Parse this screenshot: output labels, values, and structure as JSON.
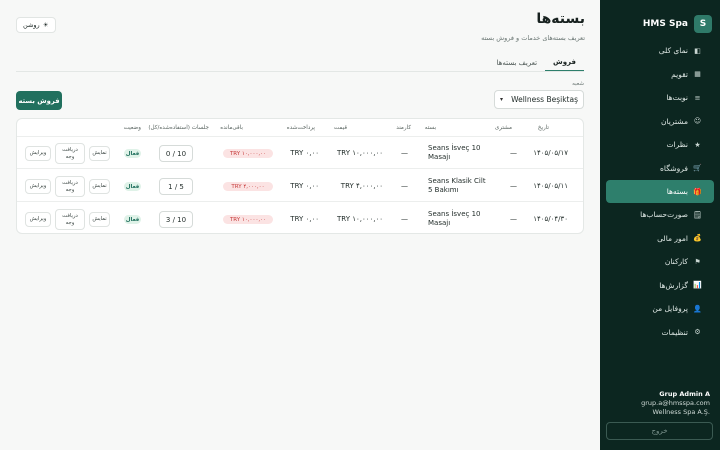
{
  "brand": {
    "logo": "S",
    "name": "HMS Spa"
  },
  "nav": [
    {
      "label": "نمای کلی",
      "icon": "dashboard-icon",
      "glyph": "◧",
      "active": false
    },
    {
      "label": "تقویم",
      "icon": "calendar-icon",
      "glyph": "▦",
      "active": false
    },
    {
      "label": "نوبت‌ها",
      "icon": "list-icon",
      "glyph": "≡",
      "active": false
    },
    {
      "label": "مشتریان",
      "icon": "users-icon",
      "glyph": "☺",
      "active": false
    },
    {
      "label": "نظرات",
      "icon": "star-icon",
      "glyph": "★",
      "active": false
    },
    {
      "label": "فروشگاه",
      "icon": "cart-icon",
      "glyph": "🛒",
      "active": false
    },
    {
      "label": "بسته‌ها",
      "icon": "gift-icon",
      "glyph": "🎁",
      "active": true
    },
    {
      "label": "صورت‌حساب‌ها",
      "icon": "receipt-icon",
      "glyph": "🗒",
      "active": false
    },
    {
      "label": "امور مالی",
      "icon": "money-icon",
      "glyph": "💰",
      "active": false
    },
    {
      "label": "کارکنان",
      "icon": "flag-icon",
      "glyph": "⚑",
      "active": false
    },
    {
      "label": "گزارش‌ها",
      "icon": "report-icon",
      "glyph": "📊",
      "active": false
    },
    {
      "label": "پروفایل من",
      "icon": "profile-icon",
      "glyph": "👤",
      "active": false
    },
    {
      "label": "تنظیمات",
      "icon": "gear-icon",
      "glyph": "⚙",
      "active": false
    }
  ],
  "user": {
    "name": "Grup Admin A",
    "email": "grup.a@hmsspa.com",
    "company": "Wellness Spa A.Ş."
  },
  "logout_label": "خروج",
  "page": {
    "title": "بسته‌ها",
    "subtitle": "تعریف بسته‌های خدمات و فروش بسته",
    "theme_label": "روشن",
    "theme_glyph": "☀"
  },
  "tabs": [
    {
      "label": "فروش",
      "active": true
    },
    {
      "label": "تعریف بسته‌ها",
      "active": false
    }
  ],
  "filter": {
    "label": "شعبه",
    "value": "Wellness Beşiktaş",
    "chevron": "▾"
  },
  "sell_button": "فروش بسته",
  "table": {
    "headers": {
      "date": "تاریخ",
      "customer": "مشتری",
      "package": "بسته",
      "staff": "کارمند",
      "price": "قیمت",
      "paid": "پرداخت‌شده",
      "remaining": "باقی‌مانده",
      "sessions": "جلسات (استفاده‌شده/کل)",
      "status": "وضعیت"
    },
    "rows": [
      {
        "date": "۱۴۰۵/۰۵/۱۷",
        "customer": "—",
        "package": "Seans İsveç 10 Masajı",
        "staff": "—",
        "price": "TRY ۱۰,۰۰۰,۰۰",
        "paid": "TRY ۰,۰۰",
        "remaining": "TRY ۱۰,۰۰۰,۰۰",
        "sessions": "0 / 10",
        "status": "فعال"
      },
      {
        "date": "۱۴۰۵/۰۵/۱۱",
        "customer": "—",
        "package": "Seans Klasik Cilt 5 Bakımı",
        "staff": "—",
        "price": "TRY ۴,۰۰۰,۰۰",
        "paid": "TRY ۰,۰۰",
        "remaining": "TRY ۴,۰۰۰,۰۰",
        "sessions": "1 / 5",
        "status": "فعال"
      },
      {
        "date": "۱۴۰۵/۰۴/۳۰",
        "customer": "—",
        "package": "Seans İsveç 10 Masajı",
        "staff": "—",
        "price": "TRY ۱۰,۰۰۰,۰۰",
        "paid": "TRY ۰,۰۰",
        "remaining": "TRY ۱۰,۰۰۰,۰۰",
        "sessions": "3 / 10",
        "status": "فعال"
      }
    ],
    "actions": {
      "view": "نمایش",
      "receive": "دریافت وجه",
      "edit": "ویرایش"
    }
  }
}
